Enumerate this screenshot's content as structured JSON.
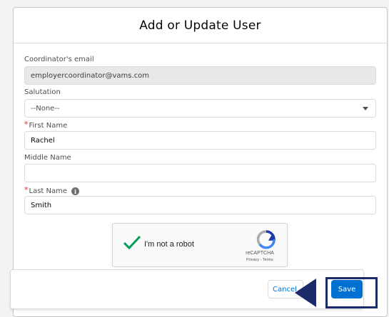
{
  "modal": {
    "title": "Add or Update User"
  },
  "fields": {
    "coordinator_email": {
      "label": "Coordinator's email",
      "value": "employercoordinator@vams.com"
    },
    "salutation": {
      "label": "Salutation",
      "value": "--None--"
    },
    "first_name": {
      "label": "First Name",
      "value": "Rachel",
      "required_mark": "*"
    },
    "middle_name": {
      "label": "Middle Name",
      "value": ""
    },
    "last_name": {
      "label": "Last Name",
      "value": "Smith",
      "required_mark": "*"
    }
  },
  "info_icon_glyph": "i",
  "recaptcha": {
    "label": "I'm not a robot",
    "brand": "reCAPTCHA",
    "terms": "Privacy - Terms"
  },
  "footer": {
    "cancel_label": "Cancel",
    "save_label": "Save"
  },
  "colors": {
    "accent": "#0070d2",
    "highlight": "#1b2a68",
    "required": "#c23934"
  }
}
